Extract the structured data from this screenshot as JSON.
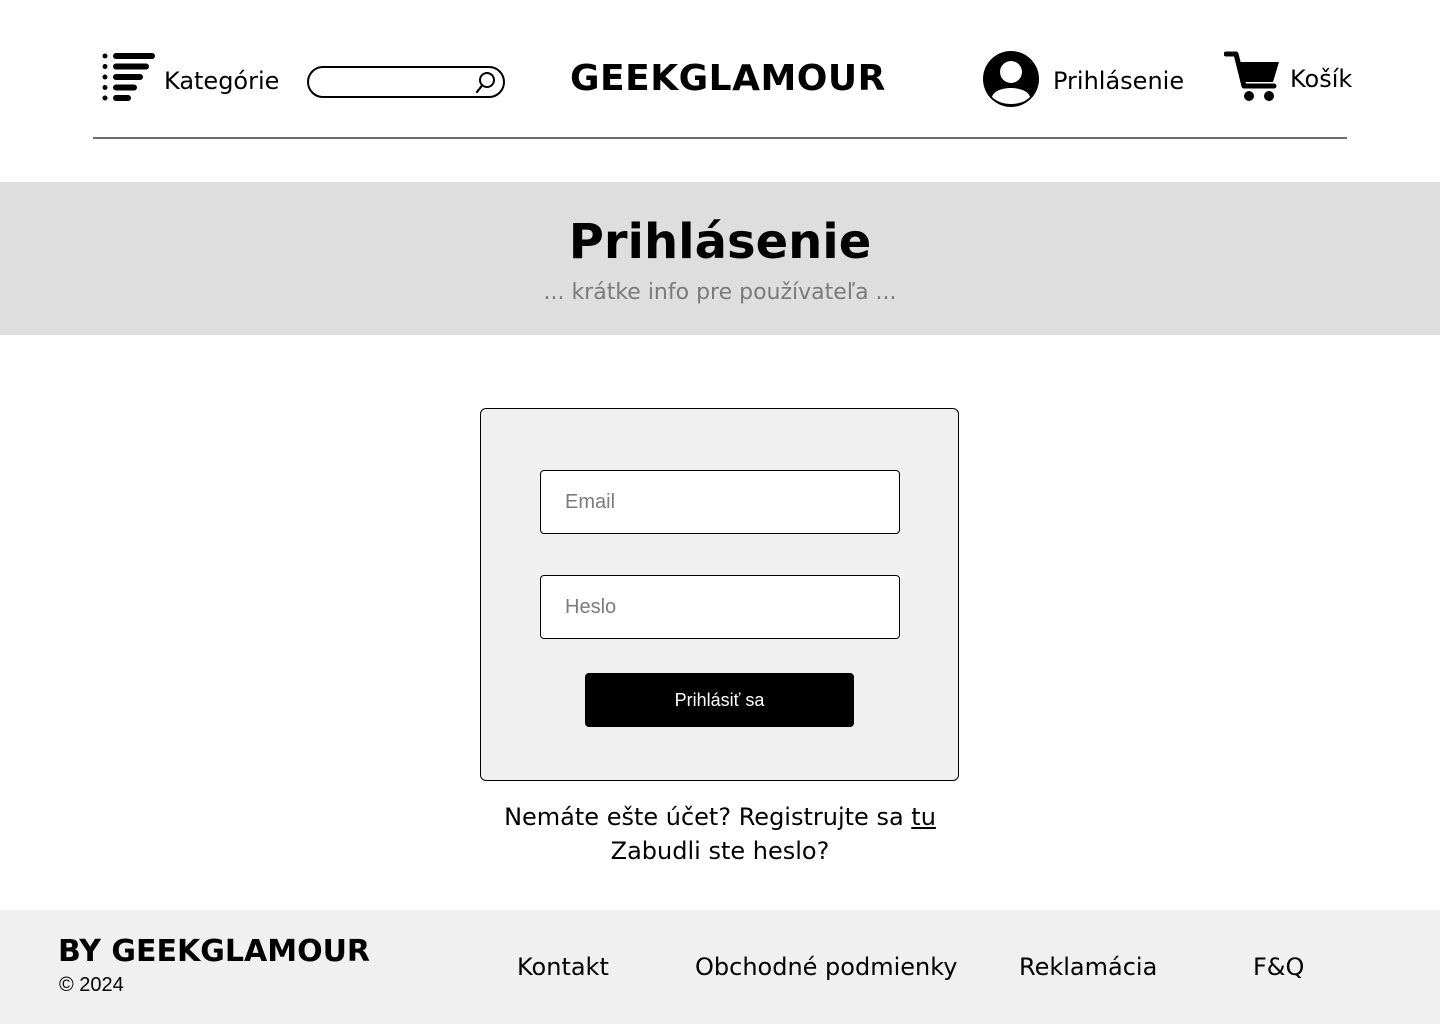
{
  "header": {
    "categories_label": "Kategórie",
    "search": {
      "placeholder": "",
      "value": ""
    },
    "logo": "GEEKGLAMOUR",
    "login_label": "Prihlásenie",
    "cart_label": "Košík"
  },
  "hero": {
    "title": "Prihlásenie",
    "subtitle": "... krátke info pre používateľa ..."
  },
  "login_form": {
    "email_placeholder": "Email",
    "password_placeholder": "Heslo",
    "submit_label": "Prihlásiť sa",
    "register_text": "Nemáte ešte účet? Registrujte sa ",
    "register_link": "tu",
    "forgot_password": "Zabudli ste heslo?"
  },
  "footer": {
    "brand": "BY GEEKGLAMOUR",
    "copyright": "© 2024",
    "links": [
      "Kontakt",
      "Obchodné podmienky",
      "Reklamácia",
      "F&Q"
    ]
  },
  "colors": {
    "hero_bg": "#dedede",
    "card_bg": "#f0f0f0",
    "footer_bg": "#f0f0f0",
    "button_bg": "#000000",
    "subtitle_text": "#7a7a7a"
  },
  "icons": [
    "categories-list-icon",
    "search-icon",
    "user-avatar-icon",
    "cart-icon"
  ]
}
